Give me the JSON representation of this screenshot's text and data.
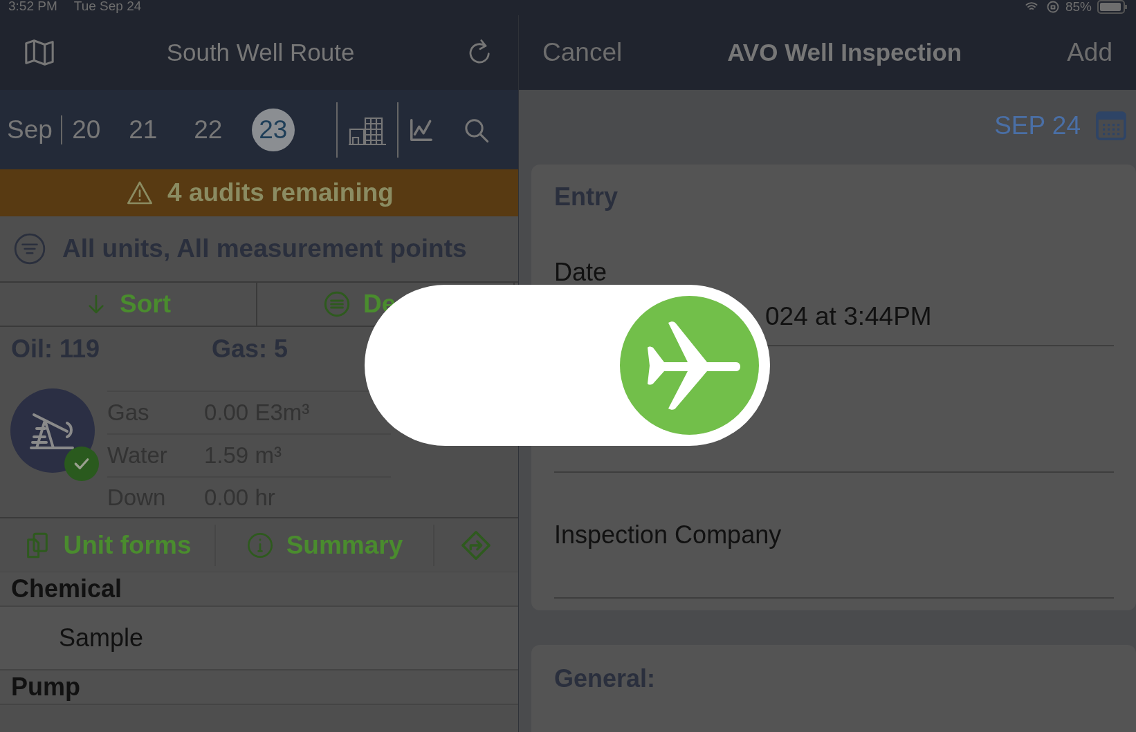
{
  "status_bar": {
    "time": "3:52 PM",
    "date": "Tue Sep 24",
    "battery": "85%"
  },
  "route_panel": {
    "title": "South Well Route",
    "month": "Sep",
    "days": [
      {
        "label": "20",
        "selected": false
      },
      {
        "label": "21",
        "selected": false
      },
      {
        "label": "22",
        "selected": false
      },
      {
        "label": "23",
        "selected": true
      }
    ],
    "banner": "4 audits remaining",
    "filter": "All units, All measurement points",
    "toolbar": [
      "Sort",
      "De"
    ],
    "totals": [
      "Oil: 119",
      "Gas: 5"
    ],
    "unit": {
      "checked": true,
      "readings": [
        {
          "name": "Gas",
          "value": "0.00 E3m³"
        },
        {
          "name": "Water",
          "value": "1.59 m³"
        },
        {
          "name": "Down",
          "value": "0.00 hr"
        }
      ]
    },
    "unit_actions": [
      "Unit forms",
      "Summary"
    ],
    "list": [
      {
        "kind": "header",
        "text": "Chemical"
      },
      {
        "kind": "item",
        "text": "Sample"
      },
      {
        "kind": "header",
        "text": "Pump"
      }
    ]
  },
  "form_panel": {
    "cancel": "Cancel",
    "title": "AVO Well Inspection",
    "add": "Add",
    "date_chip": "SEP 24",
    "entry_card": {
      "title": "Entry",
      "date_label": "Date",
      "date_value": "024 at 3:44PM",
      "company_label": "Inspection Company"
    },
    "general_card": {
      "title": "General:"
    }
  },
  "airplane_mode": {
    "on": true
  }
}
